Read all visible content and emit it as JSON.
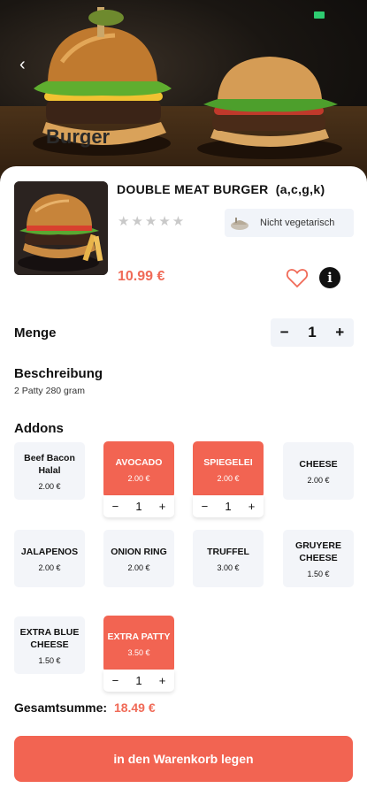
{
  "hero": {
    "title": "Burger"
  },
  "product": {
    "name": "DOUBLE MEAT BURGER",
    "allergens": "(a,c,g,k)",
    "rating_stars": "★★★★★",
    "veg_label": "Nicht vegetarisch",
    "price": "10.99 €"
  },
  "quantity": {
    "label": "Menge",
    "minus": "−",
    "value": "1",
    "plus": "+"
  },
  "description": {
    "label": "Beschreibung",
    "text": "2 Patty 280 gram"
  },
  "addons": {
    "label": "Addons",
    "items": [
      {
        "name": "Beef Bacon Halal",
        "price": "2.00 €",
        "selected": false
      },
      {
        "name": "AVOCADO",
        "price": "2.00 €",
        "selected": true,
        "qty": "1"
      },
      {
        "name": "SPIEGELEI",
        "price": "2.00 €",
        "selected": true,
        "qty": "1"
      },
      {
        "name": "CHEESE",
        "price": "2.00 €",
        "selected": false
      },
      {
        "name": "JALAPENOS",
        "price": "2.00 €",
        "selected": false
      },
      {
        "name": "ONION RING",
        "price": "2.00 €",
        "selected": false
      },
      {
        "name": "TRUFFEL",
        "price": "3.00 €",
        "selected": false
      },
      {
        "name": "GRUYERE CHEESE",
        "price": "1.50 €",
        "selected": false
      },
      {
        "name": "EXTRA BLUE CHEESE",
        "price": "1.50 €",
        "selected": false
      },
      {
        "name": "EXTRA PATTY",
        "price": "3.50 €",
        "selected": true,
        "qty": "1"
      }
    ],
    "stepper": {
      "minus": "−",
      "plus": "+"
    }
  },
  "total": {
    "label": "Gesamtsumme:",
    "value": "18.49 €"
  },
  "cart_button": {
    "label": "in den Warenkorb legen"
  },
  "colors": {
    "accent": "#f26452",
    "tile_bg": "#f3f5f9"
  }
}
